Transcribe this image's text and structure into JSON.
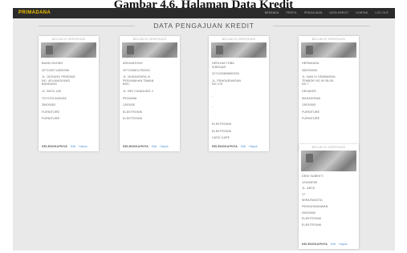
{
  "caption": "Gambar 4.6. Halaman Data Kredit",
  "navbar": {
    "brand": "PRIMADANA",
    "items": [
      "BERANDA",
      "PROFIL",
      "PENGAJUAN",
      "DATA KREDIT",
      "KONTAK",
      "LOG OUT"
    ]
  },
  "page": {
    "title": "DATA PENGAJUAN KREDIT"
  },
  "cards": [
    {
      "status": "BELUM DI VERIFIKASI",
      "fields": [
        "BANDI KUSNO",
        "3271090711850006",
        "JL. GEDUNG PENDING\nNO. 45 KANGKUNG\nBANDUNG",
        "JL. BATU 189",
        "TOYOTA AVANZA",
        "35000000",
        "FURNITURE",
        "FURNITURE"
      ],
      "actions": {
        "verify": "SELENGKAPNYA",
        "edit": "Edit",
        "delete": "Hapus"
      }
    },
    {
      "status": "BELUM DI VERIFIKASI",
      "fields": [
        "ARDIANSYAH",
        "3271090811750001",
        "JL. NUSANTARA III\nPERUMAHAN TAMAN\nBSD",
        "JL. BRI CIGADUNG 2",
        "PEGAWAI",
        "1200000",
        "ELEKTRONIK",
        "ELEKTRONIK"
      ],
      "actions": {
        "verify": "SELENGKAPNYA",
        "edit": "Edit",
        "delete": "Hapus"
      }
    },
    {
      "status": "BELUM DI VERIFIKASI",
      "fields": [
        "HERLINA TOBA\nSIREGAR",
        "3271190808850003",
        "JL. PENGARANGAN\nNO 275",
        "-",
        "-",
        "ELEKTRONIK",
        "ELEKTRONIK",
        "CASH CAPE"
      ],
      "actions": {
        "verify": "SELENGKAPNYA",
        "edit": "Edit",
        "delete": "Hapus"
      }
    },
    {
      "status": "BELUM DI VERIFIKASI",
      "fields": [
        "HERMANSA",
        "350000000",
        "JL. BAN IV KEMBARAN\nTEMBOK NO 90 BLOK\nNO 7",
        "DEVAKER",
        "MAHASISWA",
        "13000000",
        "FURNITURE",
        "FURNITURE"
      ],
      "actions": {
        "verify": "SELENGKAPNYA",
        "edit": "Edit",
        "delete": "Hapus"
      }
    },
    {
      "status": "BELUM DI VERIFIKASI",
      "fields": [
        "DENI SUBEKTI",
        "123456789",
        "JL. ANTA",
        "17",
        "WIRASWASTA",
        "PENGUSAHAWAN",
        "20000000",
        "ELEKTRONIK",
        "ELEKTRONIK"
      ],
      "actions": {
        "verify": "SELENGKAPNYA",
        "edit": "Edit",
        "delete": "Hapus"
      }
    }
  ]
}
